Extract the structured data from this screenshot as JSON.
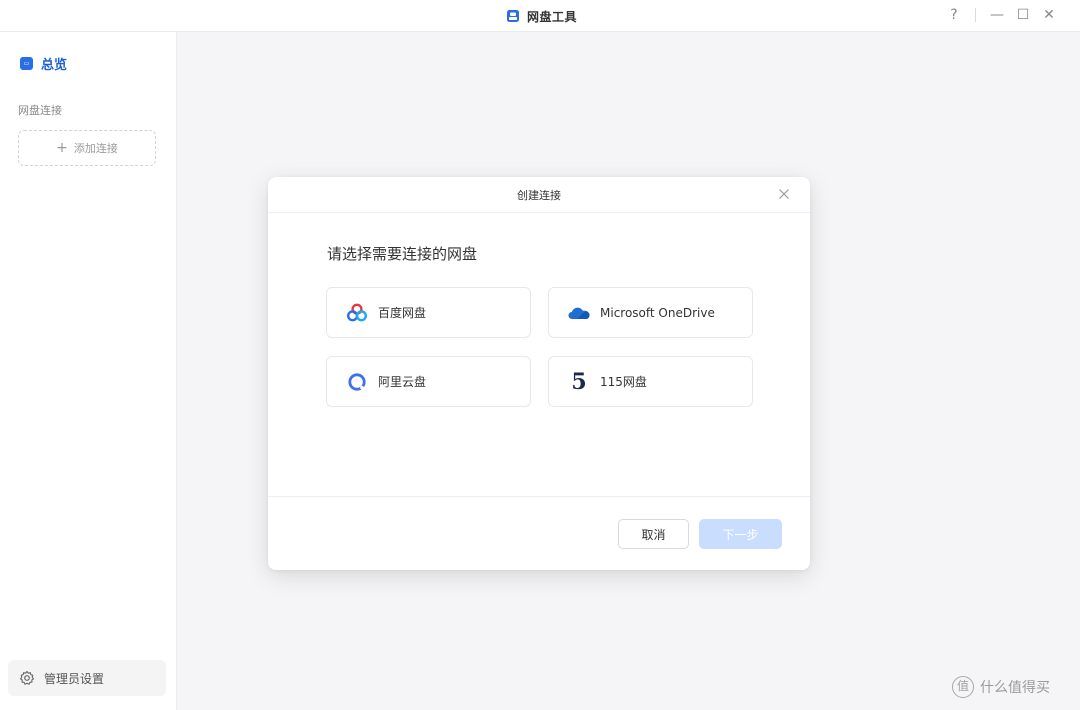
{
  "window": {
    "title": "网盘工具",
    "controls": {
      "help": "?",
      "minimize": "—",
      "maximize": "☐",
      "close": "✕"
    }
  },
  "sidebar": {
    "overview": {
      "label": "总览",
      "icon": "overview-icon"
    },
    "section_label": "网盘连接",
    "add_connection": {
      "plus": "+",
      "label": "添加连接"
    },
    "admin": {
      "label": "管理员设置",
      "icon": "gear-icon"
    }
  },
  "dialog": {
    "title": "创建连接",
    "prompt": "请选择需要连接的网盘",
    "providers": [
      {
        "name": "百度网盘",
        "icon": "baidu-netdisk-icon"
      },
      {
        "name": "Microsoft OneDrive",
        "icon": "onedrive-icon"
      },
      {
        "name": "阿里云盘",
        "icon": "aliyun-drive-icon"
      },
      {
        "name": "115网盘",
        "icon": "115-netdisk-icon",
        "icon_glyph": "5"
      }
    ],
    "cancel_label": "取消",
    "next_label": "下一步"
  },
  "watermark": {
    "icon_glyph": "值",
    "text": "什么值得买"
  },
  "colors": {
    "accent": "#1f5fd6",
    "next_disabled": "#c9ddff",
    "onedrive": "#1e6fd0",
    "aliyun": "#3d6ff0"
  }
}
